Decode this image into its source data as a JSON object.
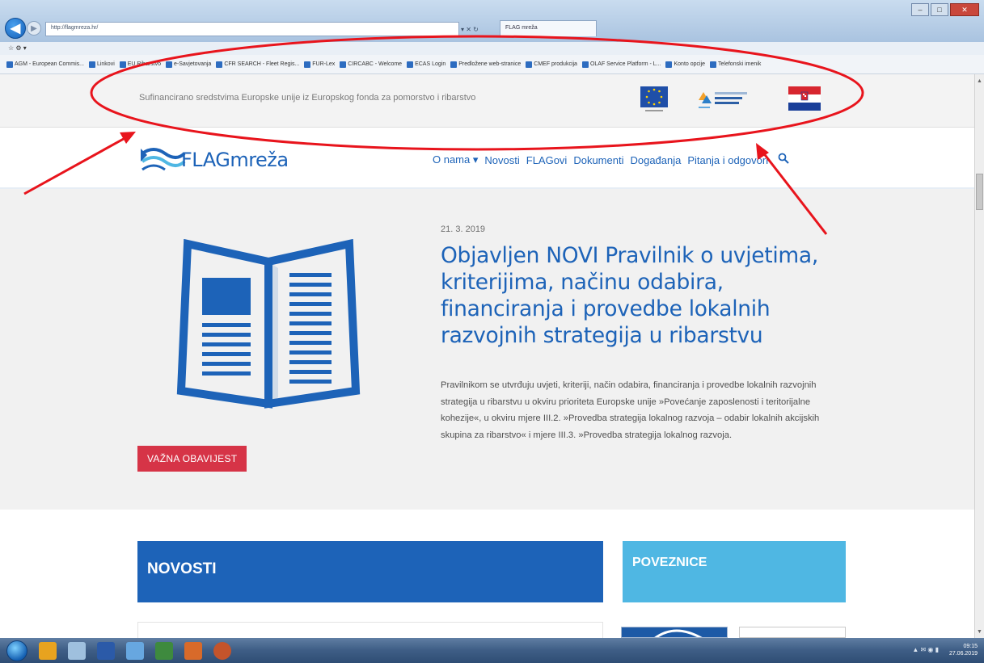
{
  "browser": {
    "window_title": "",
    "address": "http://flagmreza.hr/",
    "tab_label": "FLAG mreža",
    "back_glyph": "◀",
    "forward_glyph": "▶",
    "address_ctrls": "▾ ✕ ↻",
    "win_min": "–",
    "win_max": "□",
    "win_close": "✕",
    "menu_text": "☆ ⚙ ▾",
    "favorites": [
      "AGM - European Commis...",
      "Linkovi",
      "EU Ribarstvo",
      "e-Savjetovanja",
      "CFR SEARCH - Fleet Regis...",
      "FUR-Lex",
      "CIRCABC - Welcome",
      "ECAS Login",
      "Predložene web-stranice",
      "CMEF produkcija",
      "OLAF Service Platform - L...",
      "Konto opcije",
      "Telefonski imenik"
    ]
  },
  "site": {
    "cofinance_text": "Sufinancirano sredstvima Europske unije iz Europskog fonda za pomorstvo i ribarstvo",
    "logo_text": "FLAGmreža",
    "nav": [
      "O nama ▾",
      "Novosti",
      "FLAGovi",
      "Dokumenti",
      "Događanja",
      "Pitanja i odgovori"
    ],
    "search_glyph": "🔍",
    "hero": {
      "date": "21. 3. 2019",
      "title": "Objavljen NOVI Pravilnik o uvjetima, kriterijima, načinu odabira, financiranja i provedbe lokalnih razvojnih strategija u ribarstvu",
      "text": "Pravilnikom se utvrđuju uvjeti, kriteriji, način odabira, financiranja i provedbe lokalnih razvojnih strategija u ribarstvu u okviru prioriteta Europske unije »Povećanje zaposlenosti i teritorijalne kohezije«, u okviru mjere III.2. »Provedba strategija lokalnog razvoja – odabir lokalnih akcijskih skupina za ribarstvo« i mjere III.3. »Provedba strategija lokalnog razvoja.",
      "badge": "VAŽNA OBAVIJEST"
    },
    "novosti_label": "NOVOSTI",
    "poveznice_label": "POVEZNICE"
  },
  "taskbar": {
    "time": "09:15",
    "date": "27.06.2019"
  },
  "colors": {
    "brand_blue": "#1d63b8",
    "light_blue": "#4fb7e3",
    "badge_red": "#d63447",
    "annotation_red": "#e8141c"
  }
}
